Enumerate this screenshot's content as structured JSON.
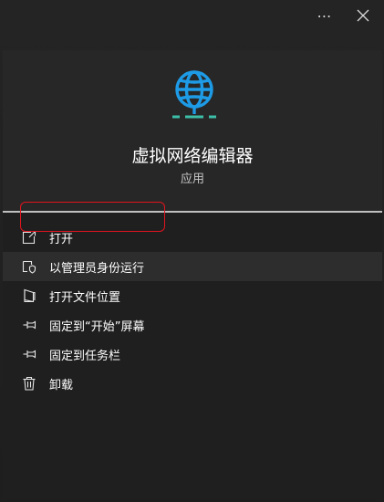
{
  "titlebar": {
    "more_label": "⋯",
    "close_label": "✕"
  },
  "app": {
    "name": "虚拟网络编辑器",
    "kind": "应用",
    "icon": "globe-network-icon",
    "accent_color": "#1e9be6",
    "base_color": "#3dbfa8"
  },
  "menu": {
    "items": [
      {
        "label": "打开",
        "icon": "open-icon"
      },
      {
        "label": "以管理员身份运行",
        "icon": "shield-icon"
      },
      {
        "label": "打开文件位置",
        "icon": "folder-icon"
      },
      {
        "label": "固定到“开始”屏幕",
        "icon": "pin-icon"
      },
      {
        "label": "固定到任务栏",
        "icon": "pin-icon"
      },
      {
        "label": "卸载",
        "icon": "trash-icon"
      }
    ],
    "highlight_color": "#e0141e"
  }
}
